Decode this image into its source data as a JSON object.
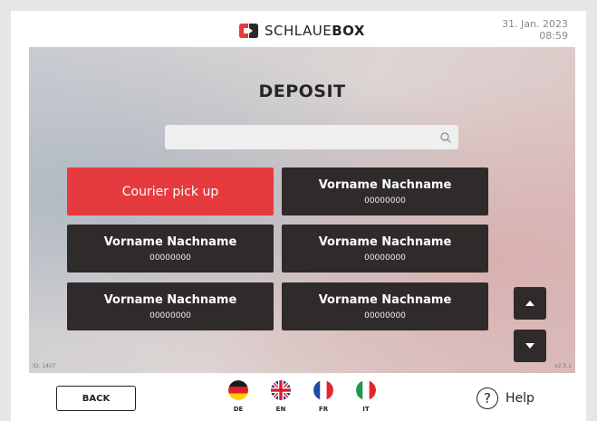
{
  "header": {
    "brand_prefix": "SCHLAUE",
    "brand_suffix": "BOX",
    "date": "31. Jan. 2023",
    "time": "08:59"
  },
  "main": {
    "title": "DEPOSIT",
    "search": {
      "value": "",
      "placeholder": ""
    },
    "courier_label": "Courier pick up",
    "recipients": [
      {
        "name": "Vorname Nachname",
        "number": "00000000"
      },
      {
        "name": "Vorname Nachname",
        "number": "00000000"
      },
      {
        "name": "Vorname Nachname",
        "number": "00000000"
      },
      {
        "name": "Vorname Nachname",
        "number": "00000000"
      },
      {
        "name": "Vorname Nachname",
        "number": "00000000"
      }
    ],
    "id_label": "ID: 1407",
    "version": "v2.5.1"
  },
  "footer": {
    "back_label": "BACK",
    "languages": [
      {
        "code": "DE"
      },
      {
        "code": "EN"
      },
      {
        "code": "FR"
      },
      {
        "code": "IT"
      }
    ],
    "help_label": "Help",
    "help_symbol": "?"
  },
  "colors": {
    "accent": "#e63b3e",
    "card": "#2f2b2b"
  }
}
